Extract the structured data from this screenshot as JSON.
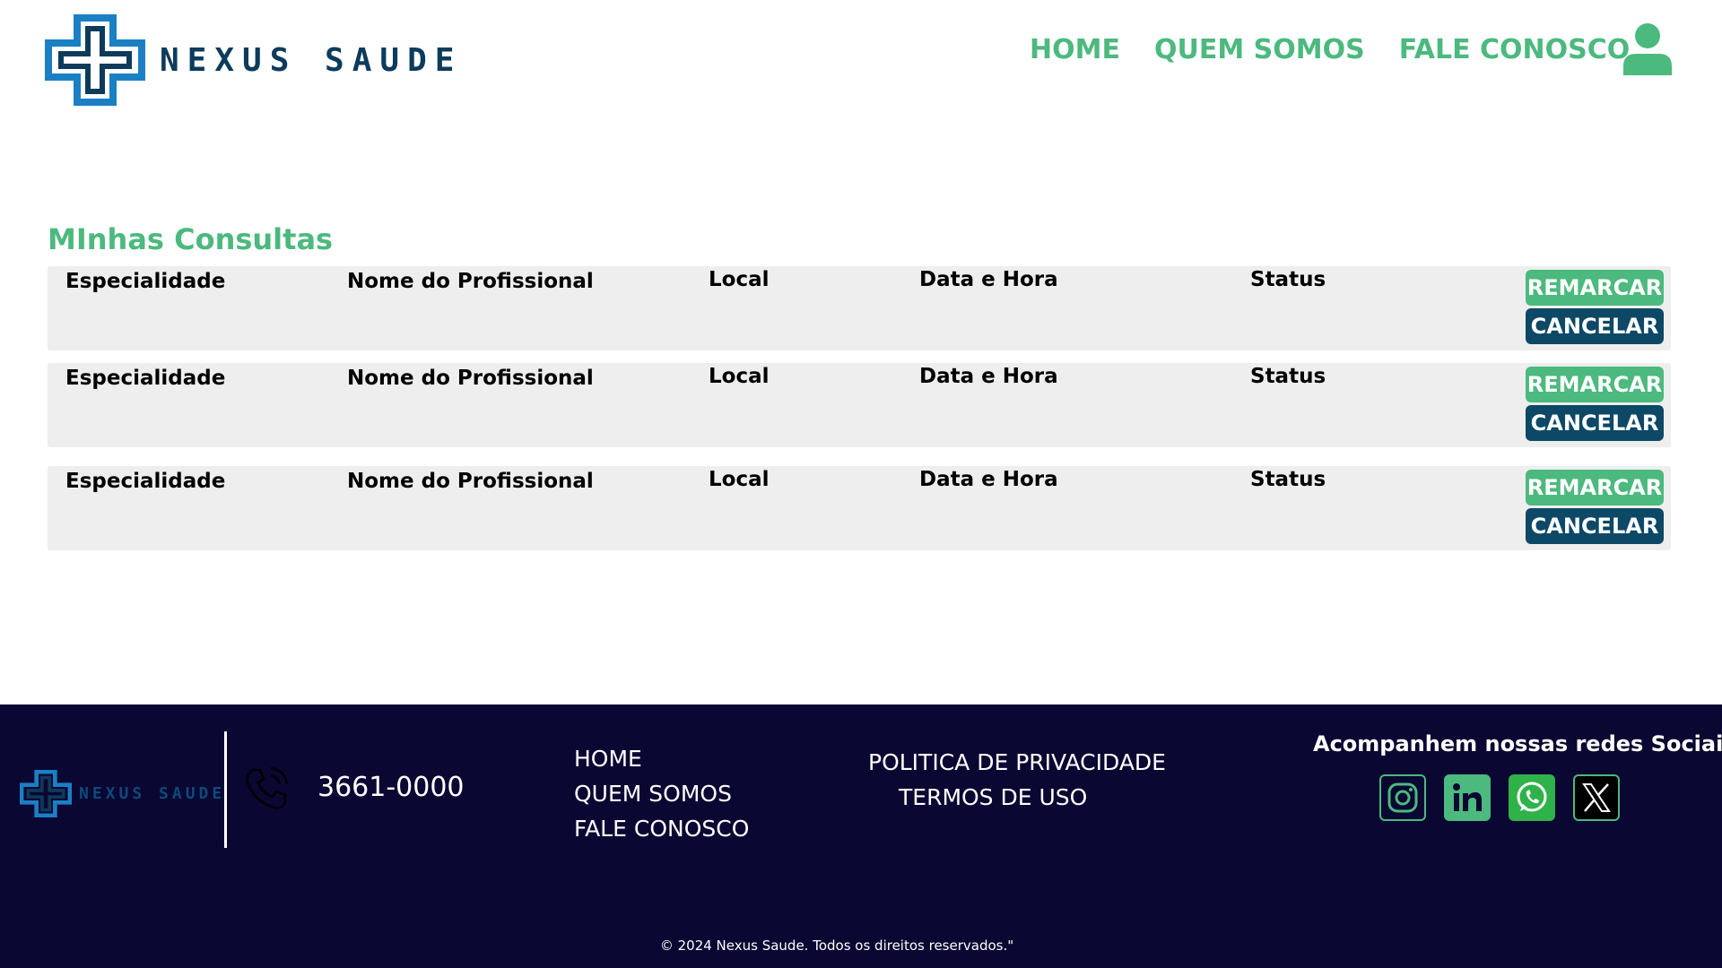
{
  "header": {
    "brand": "NEXUS SAUDE",
    "nav": [
      "HOME",
      "QUEM SOMOS",
      "FALE CONOSCO"
    ],
    "user_icon": "user-icon"
  },
  "main": {
    "title": "MInhas Consultas",
    "appointments": [
      {
        "especialidade": "Especialidade",
        "profissional": "Nome do Profissional",
        "local": "Local",
        "data_hora": "Data e Hora",
        "status": "Status",
        "reschedule_label": "REMARCAR",
        "cancel_label": "CANCELAR"
      },
      {
        "especialidade": "Especialidade",
        "profissional": "Nome do Profissional",
        "local": "Local",
        "data_hora": "Data e Hora",
        "status": "Status",
        "reschedule_label": "REMARCAR",
        "cancel_label": "CANCELAR"
      },
      {
        "especialidade": "Especialidade",
        "profissional": "Nome do Profissional",
        "local": "Local",
        "data_hora": "Data e Hora",
        "status": "Status",
        "reschedule_label": "REMARCAR",
        "cancel_label": "CANCELAR"
      }
    ]
  },
  "footer": {
    "brand": "NEXUS SAUDE",
    "phone": "3661-0000",
    "links": [
      "HOME",
      "QUEM SOMOS",
      "FALE CONOSCO"
    ],
    "privacy": "POLITICA DE PRIVACIDADE",
    "terms": "TERMOS DE USO",
    "social_title": "Acompanhem nossas redes Sociais",
    "social_icons": [
      "instagram-icon",
      "linkedin-icon",
      "whatsapp-icon",
      "x-icon"
    ],
    "copyright": "© 2024 Nexus Saude. Todos os direitos reservados.\""
  },
  "colors": {
    "accent_green": "#4cb97e",
    "dark_teal": "#0d4866",
    "footer_bg": "#0a0732",
    "row_bg": "#eeeeee"
  }
}
